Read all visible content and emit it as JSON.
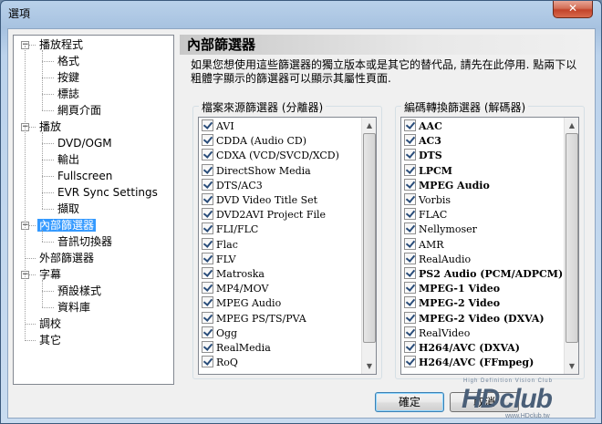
{
  "window": {
    "title": "選項",
    "close_label": "✕"
  },
  "tree": {
    "items": [
      {
        "label": "播放程式",
        "level": 0,
        "expander": "−"
      },
      {
        "label": "格式",
        "level": 1
      },
      {
        "label": "按鍵",
        "level": 1
      },
      {
        "label": "標誌",
        "level": 1
      },
      {
        "label": "網頁介面",
        "level": 1
      },
      {
        "label": "播放",
        "level": 0,
        "expander": "−"
      },
      {
        "label": "DVD/OGM",
        "level": 1
      },
      {
        "label": "輸出",
        "level": 1
      },
      {
        "label": "Fullscreen",
        "level": 1
      },
      {
        "label": "EVR Sync Settings",
        "level": 1
      },
      {
        "label": "擷取",
        "level": 1
      },
      {
        "label": "內部篩選器",
        "level": 0,
        "expander": "−",
        "selected": true
      },
      {
        "label": "音訊切換器",
        "level": 1
      },
      {
        "label": "外部篩選器",
        "level": 0
      },
      {
        "label": "字幕",
        "level": 0,
        "expander": "−"
      },
      {
        "label": "預設樣式",
        "level": 1
      },
      {
        "label": "資料庫",
        "level": 1
      },
      {
        "label": "調校",
        "level": 0
      },
      {
        "label": "其它",
        "level": 0
      }
    ]
  },
  "page": {
    "title": "內部篩選器",
    "description": "如果您想使用這些篩選器的獨立版本或是其它的替代品, 請先在此停用. 點兩下以粗體字顯示的篩選器可以顯示其屬性頁面."
  },
  "source_filters": {
    "label": "檔案來源篩選器 (分離器)",
    "items": [
      {
        "label": "AVI",
        "checked": true,
        "bold": false
      },
      {
        "label": "CDDA (Audio CD)",
        "checked": true,
        "bold": false
      },
      {
        "label": "CDXA (VCD/SVCD/XCD)",
        "checked": true,
        "bold": false
      },
      {
        "label": "DirectShow Media",
        "checked": true,
        "bold": false
      },
      {
        "label": "DTS/AC3",
        "checked": true,
        "bold": false
      },
      {
        "label": "DVD Video Title Set",
        "checked": true,
        "bold": false
      },
      {
        "label": "DVD2AVI Project File",
        "checked": true,
        "bold": false
      },
      {
        "label": "FLI/FLC",
        "checked": true,
        "bold": false
      },
      {
        "label": "Flac",
        "checked": true,
        "bold": false
      },
      {
        "label": "FLV",
        "checked": true,
        "bold": false
      },
      {
        "label": "Matroska",
        "checked": true,
        "bold": false
      },
      {
        "label": "MP4/MOV",
        "checked": true,
        "bold": false
      },
      {
        "label": "MPEG Audio",
        "checked": true,
        "bold": false
      },
      {
        "label": "MPEG PS/TS/PVA",
        "checked": true,
        "bold": false
      },
      {
        "label": "Ogg",
        "checked": true,
        "bold": false
      },
      {
        "label": "RealMedia",
        "checked": true,
        "bold": false
      },
      {
        "label": "RoQ",
        "checked": true,
        "bold": false
      }
    ],
    "scroll_fraction": 0.0
  },
  "transform_filters": {
    "label": "編碼轉換篩選器 (解碼器)",
    "items": [
      {
        "label": "AAC",
        "checked": true,
        "bold": true
      },
      {
        "label": "AC3",
        "checked": true,
        "bold": true
      },
      {
        "label": "DTS",
        "checked": true,
        "bold": true
      },
      {
        "label": "LPCM",
        "checked": true,
        "bold": true
      },
      {
        "label": "MPEG Audio",
        "checked": true,
        "bold": true
      },
      {
        "label": "Vorbis",
        "checked": true,
        "bold": false
      },
      {
        "label": "FLAC",
        "checked": true,
        "bold": false
      },
      {
        "label": "Nellymoser",
        "checked": true,
        "bold": false
      },
      {
        "label": "AMR",
        "checked": true,
        "bold": false
      },
      {
        "label": "RealAudio",
        "checked": true,
        "bold": false
      },
      {
        "label": "PS2 Audio (PCM/ADPCM)",
        "checked": true,
        "bold": true
      },
      {
        "label": "MPEG-1 Video",
        "checked": true,
        "bold": true
      },
      {
        "label": "MPEG-2 Video",
        "checked": true,
        "bold": true
      },
      {
        "label": "MPEG-2 Video (DXVA)",
        "checked": true,
        "bold": true
      },
      {
        "label": "RealVideo",
        "checked": true,
        "bold": false
      },
      {
        "label": "H264/AVC (DXVA)",
        "checked": true,
        "bold": true
      },
      {
        "label": "H264/AVC (FFmpeg)",
        "checked": true,
        "bold": true
      }
    ],
    "scroll_fraction": 0.0
  },
  "buttons": {
    "ok": "確定",
    "cancel": "取消"
  },
  "watermark": {
    "text": "HDclub",
    "tagline": "High Definition Vision Club",
    "url": "www.HDclub.tw"
  }
}
